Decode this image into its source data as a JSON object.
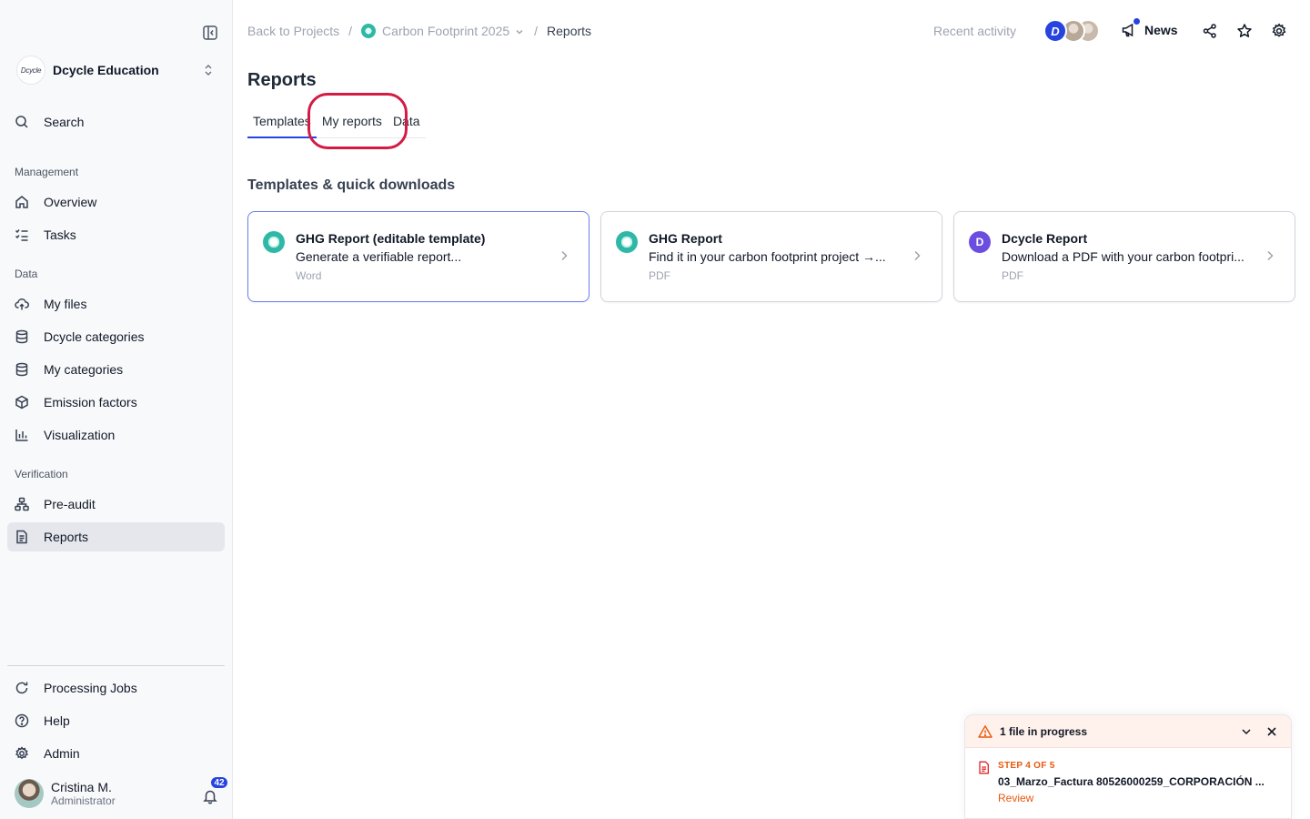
{
  "org": {
    "logo_text": "Dcycle",
    "name": "Dcycle Education"
  },
  "sidebar": {
    "search_label": "Search",
    "sections": {
      "management": "Management",
      "data": "Data",
      "verification": "Verification"
    },
    "items": [
      {
        "label": "Overview",
        "icon": "home-icon"
      },
      {
        "label": "Tasks",
        "icon": "tasks-icon"
      },
      {
        "label": "My files",
        "icon": "upload-cloud-icon"
      },
      {
        "label": "Dcycle categories",
        "icon": "database-icon"
      },
      {
        "label": "My categories",
        "icon": "database-icon"
      },
      {
        "label": "Emission factors",
        "icon": "cube-icon"
      },
      {
        "label": "Visualization",
        "icon": "bar-chart-icon"
      },
      {
        "label": "Pre-audit",
        "icon": "hierarchy-icon"
      },
      {
        "label": "Reports",
        "icon": "document-icon",
        "active": true
      }
    ],
    "bottom": [
      {
        "label": "Processing Jobs",
        "icon": "refresh-icon"
      },
      {
        "label": "Help",
        "icon": "help-circle-icon"
      },
      {
        "label": "Admin",
        "icon": "gear-icon"
      }
    ],
    "user": {
      "name": "Cristina M.",
      "role": "Administrator",
      "notifications": "42"
    }
  },
  "header": {
    "breadcrumb": {
      "back": "Back to Projects",
      "separator": "/",
      "project": "Carbon Footprint 2025",
      "current": "Reports"
    },
    "recent_activity": "Recent activity",
    "news_label": "News"
  },
  "main": {
    "title": "Reports",
    "tabs": [
      {
        "label": "Templates",
        "active": true
      },
      {
        "label": "My reports"
      },
      {
        "label": "Data"
      }
    ],
    "section_title": "Templates & quick downloads",
    "cards": [
      {
        "title": "GHG Report (editable template)",
        "description": "Generate a verifiable report...",
        "format": "Word",
        "icon": "teal-circle-icon"
      },
      {
        "title": "GHG Report",
        "description": "Find it in your carbon footprint project →...",
        "format": "PDF",
        "icon": "teal-circle-icon"
      },
      {
        "title": "Dcycle Report",
        "description": "Download a PDF with your carbon footpri...",
        "format": "PDF",
        "icon": "dcycle-logo-icon"
      }
    ]
  },
  "progress": {
    "title": "1 file in progress",
    "step": "STEP 4 OF 5",
    "file_name": "03_Marzo_Factura 80526000259_CORPORACIÓN ...",
    "action": "Review"
  },
  "colors": {
    "accent": "#2743e0",
    "warning": "#ea580c",
    "highlight": "#d31b45",
    "teal": "#2fb8a6",
    "violet": "#6b4ee0"
  }
}
